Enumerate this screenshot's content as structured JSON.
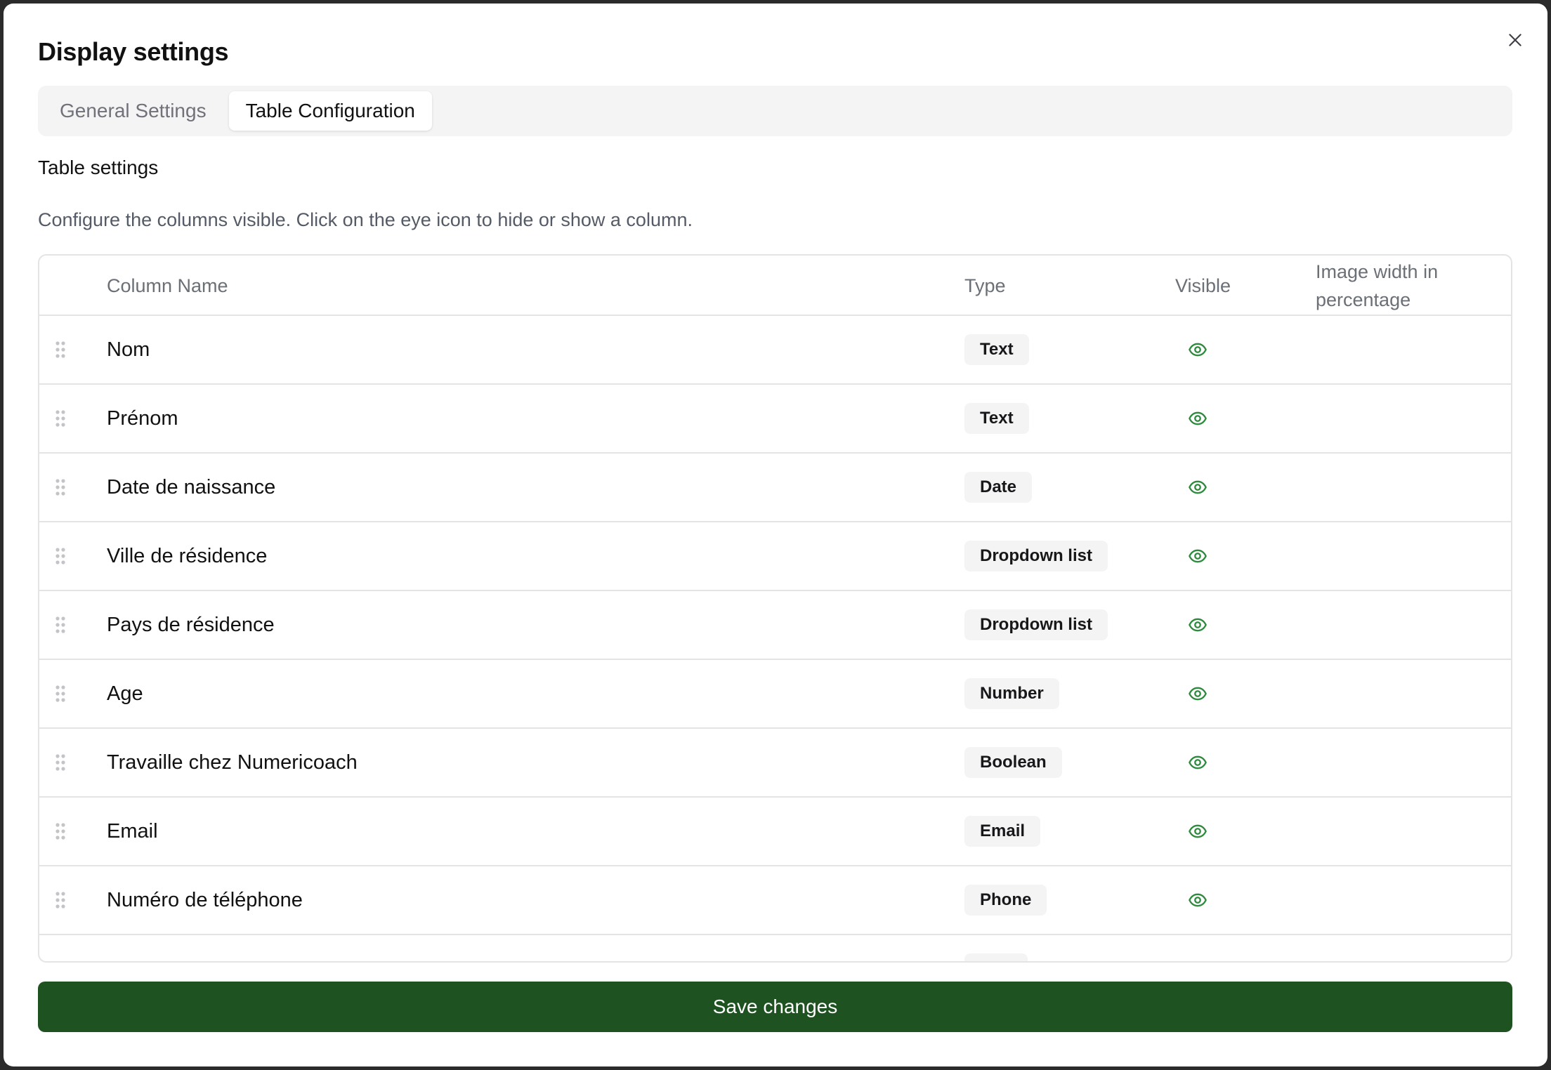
{
  "dialog": {
    "title": "Display settings"
  },
  "tabs": [
    {
      "label": "General Settings",
      "active": false
    },
    {
      "label": "Table Configuration",
      "active": true
    }
  ],
  "section": {
    "title": "Table settings",
    "description": "Configure the columns visible. Click on the eye icon to hide or show a column."
  },
  "table": {
    "headers": {
      "name": "Column Name",
      "type": "Type",
      "visible": "Visible",
      "image_width": "Image width in percentage"
    },
    "rows": [
      {
        "name": "Nom",
        "type": "Text",
        "visible": true
      },
      {
        "name": "Prénom",
        "type": "Text",
        "visible": true
      },
      {
        "name": "Date de naissance",
        "type": "Date",
        "visible": true
      },
      {
        "name": "Ville de résidence",
        "type": "Dropdown list",
        "visible": true
      },
      {
        "name": "Pays de résidence",
        "type": "Dropdown list",
        "visible": true
      },
      {
        "name": "Age",
        "type": "Number",
        "visible": true
      },
      {
        "name": "Travaille chez Numericoach",
        "type": "Boolean",
        "visible": true
      },
      {
        "name": "Email",
        "type": "Email",
        "visible": true
      },
      {
        "name": "Numéro de téléphone",
        "type": "Phone",
        "visible": true
      }
    ]
  },
  "footer": {
    "save_label": "Save changes"
  },
  "colors": {
    "accent": "#1e5220",
    "eye_icon": "#2e8b3e",
    "badge_bg": "#f4f4f5"
  },
  "icons": {
    "close": "close-icon",
    "drag": "drag-handle-icon",
    "visible": "eye-icon"
  }
}
